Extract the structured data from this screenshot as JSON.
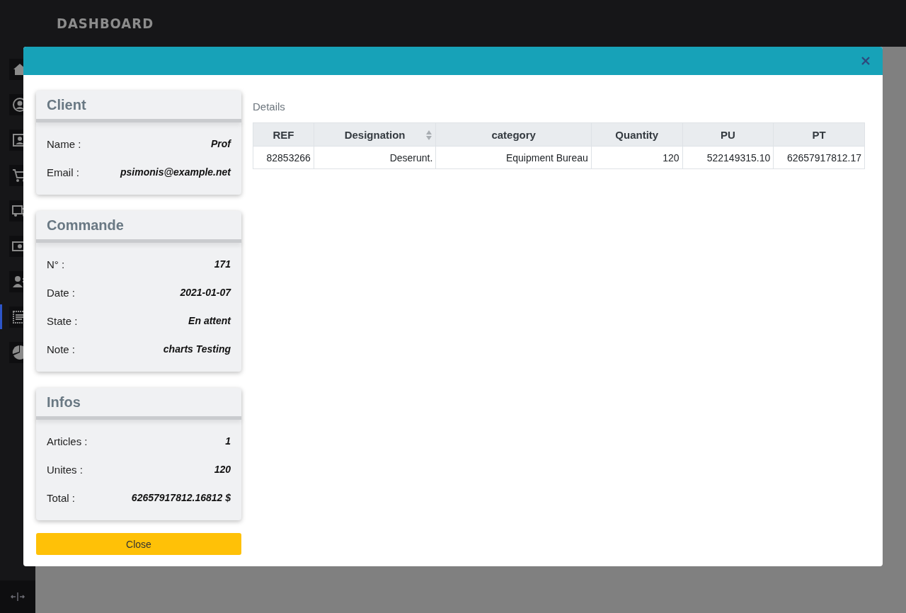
{
  "brand": "DASHBOARD",
  "sidebar": {
    "items": [
      {
        "selected": false
      },
      {
        "selected": false
      },
      {
        "selected": false
      },
      {
        "selected": false
      },
      {
        "selected": false
      },
      {
        "selected": false
      },
      {
        "selected": false
      },
      {
        "selected": true
      },
      {
        "selected": false
      }
    ]
  },
  "cards": [
    {
      "title": "Client",
      "rows": [
        {
          "label": "Name :",
          "value": "Prof"
        },
        {
          "label": "Email :",
          "value": "psimonis@example.net"
        }
      ]
    },
    {
      "title": "Commande",
      "rows": [
        {
          "label": "N° :",
          "value": "171"
        },
        {
          "label": "Date :",
          "value": "2021-01-07"
        },
        {
          "label": "State :",
          "value": "En attent"
        },
        {
          "label": "Note :",
          "value": "charts Testing"
        }
      ]
    },
    {
      "title": "Infos",
      "rows": [
        {
          "label": "Articles :",
          "value": "1"
        },
        {
          "label": "Unites :",
          "value": "120"
        },
        {
          "label": "Total :",
          "value": "62657917812.16812 $"
        }
      ]
    }
  ],
  "close_button": "Close",
  "details": {
    "title": "Details",
    "table": {
      "columns": [
        {
          "label": "REF",
          "sortable": false
        },
        {
          "label": "Designation",
          "sortable": true
        },
        {
          "label": "category",
          "sortable": false
        },
        {
          "label": "Quantity",
          "sortable": false
        },
        {
          "label": "PU",
          "sortable": false
        },
        {
          "label": "PT",
          "sortable": false
        }
      ],
      "rows": [
        [
          "82853266",
          "Deserunt.",
          "Equipment Bureau",
          "120",
          "522149315.10",
          "62657917812.17"
        ]
      ]
    }
  }
}
